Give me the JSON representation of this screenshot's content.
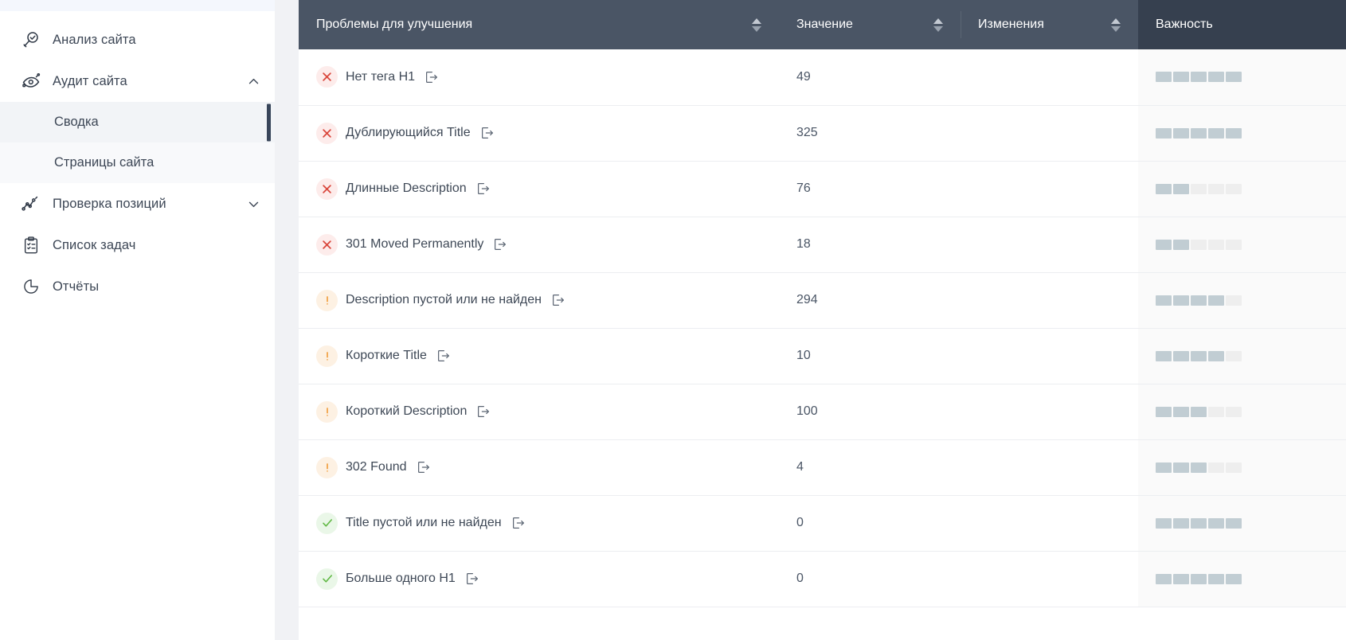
{
  "sidebar": {
    "items": [
      {
        "label": "Анализ сайта",
        "icon": "magnifier-check-icon",
        "chevron": null,
        "expanded": false
      },
      {
        "label": "Аудит сайта",
        "icon": "eye-audit-icon",
        "chevron": "chevron-up-icon",
        "expanded": true
      },
      {
        "label": "Проверка позиций",
        "icon": "line-chart-icon",
        "chevron": "chevron-down-icon",
        "expanded": false
      },
      {
        "label": "Список задач",
        "icon": "clipboard-list-icon",
        "chevron": null,
        "expanded": false
      },
      {
        "label": "Отчёты",
        "icon": "pie-chart-icon",
        "chevron": null,
        "expanded": false
      }
    ],
    "submenu": [
      {
        "label": "Сводка",
        "active": true
      },
      {
        "label": "Страницы сайта",
        "active": false
      }
    ]
  },
  "table": {
    "columns": [
      {
        "key": "problem",
        "label": "Проблемы для улучшения",
        "sortable": true,
        "sorted": "asc"
      },
      {
        "key": "value",
        "label": "Значение",
        "sortable": true,
        "sorted": null
      },
      {
        "key": "change",
        "label": "Изменения",
        "sortable": true,
        "sorted": null
      },
      {
        "key": "weight",
        "label": "Важность",
        "sortable": false,
        "sorted": null
      }
    ],
    "detail_icon": "open-detail-icon",
    "weight_max": 5,
    "rows": [
      {
        "status": "error",
        "status_icon": "cross-icon",
        "problem": "Нет тега H1",
        "value": "49",
        "change": "",
        "weight": 5
      },
      {
        "status": "error",
        "status_icon": "cross-icon",
        "problem": "Дублирующийся Title",
        "value": "325",
        "change": "",
        "weight": 5
      },
      {
        "status": "error",
        "status_icon": "cross-icon",
        "problem": "Длинные Description",
        "value": "76",
        "change": "",
        "weight": 2
      },
      {
        "status": "error",
        "status_icon": "cross-icon",
        "problem": "301 Moved Permanently",
        "value": "18",
        "change": "",
        "weight": 2
      },
      {
        "status": "warning",
        "status_icon": "exclamation-icon",
        "problem": "Description пустой или не найден",
        "value": "294",
        "change": "",
        "weight": 4
      },
      {
        "status": "warning",
        "status_icon": "exclamation-icon",
        "problem": "Короткие Title",
        "value": "10",
        "change": "",
        "weight": 4
      },
      {
        "status": "warning",
        "status_icon": "exclamation-icon",
        "problem": "Короткий Description",
        "value": "100",
        "change": "",
        "weight": 3
      },
      {
        "status": "warning",
        "status_icon": "exclamation-icon",
        "problem": "302 Found",
        "value": "4",
        "change": "",
        "weight": 3
      },
      {
        "status": "ok",
        "status_icon": "check-icon",
        "problem": "Title пустой или не найден",
        "value": "0",
        "change": "",
        "weight": 5
      },
      {
        "status": "ok",
        "status_icon": "check-icon",
        "problem": "Больше одного H1",
        "value": "0",
        "change": "",
        "weight": 5
      }
    ]
  },
  "colors": {
    "header_bg": "#4a5565",
    "header_pinned_bg": "#36404f",
    "error": "#d9453a",
    "warning": "#f0962e",
    "ok": "#62b946",
    "weight_on": "#c1cdd3",
    "weight_off": "#eeeeee",
    "active_bar": "#38455a"
  }
}
